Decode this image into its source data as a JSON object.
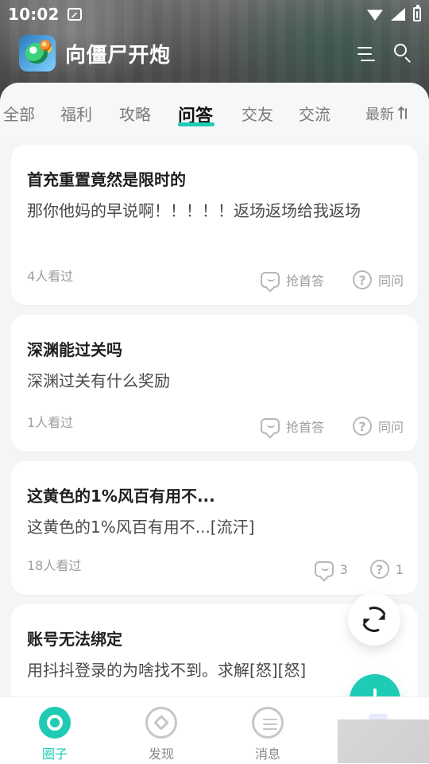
{
  "status": {
    "time": "10:02"
  },
  "header": {
    "title": "向僵尸开炮"
  },
  "tabs": {
    "items": [
      {
        "label": "全部"
      },
      {
        "label": "福利"
      },
      {
        "label": "攻略"
      },
      {
        "label": "问答"
      },
      {
        "label": "交友"
      },
      {
        "label": "交流"
      }
    ],
    "active": "问答",
    "sort_label": "最新"
  },
  "posts": [
    {
      "title": "首充重置竟然是限时的",
      "body": "那你他妈的早说啊！！！！！返场返场给我返场",
      "views": "4人看过",
      "answer_label": "抢首答",
      "ask_label": "同问"
    },
    {
      "title": "深渊能过关吗",
      "body": "深渊过关有什么奖励",
      "views": "1人看过",
      "answer_label": "抢首答",
      "ask_label": "同问"
    },
    {
      "title": "这黄色的1%风百有用不...",
      "body": "这黄色的1%风百有用不...[流汗]",
      "views": "18人看过",
      "answer_count": "3",
      "ask_count": "1"
    },
    {
      "title": "账号无法绑定",
      "body": "用抖抖登录的为啥找不到。求解[怒][怒]"
    }
  ],
  "bottom_nav": {
    "items": [
      {
        "label": "圈子"
      },
      {
        "label": "发现"
      },
      {
        "label": "消息"
      }
    ]
  },
  "colors": {
    "accent": "#1fcbb5"
  },
  "icons": {
    "menu": "menu-icon",
    "search": "search-icon",
    "refresh": "refresh-icon",
    "add": "plus-icon",
    "answer": "chat-bubble-icon",
    "ask": "question-circle-icon",
    "sort": "sort-icon"
  }
}
